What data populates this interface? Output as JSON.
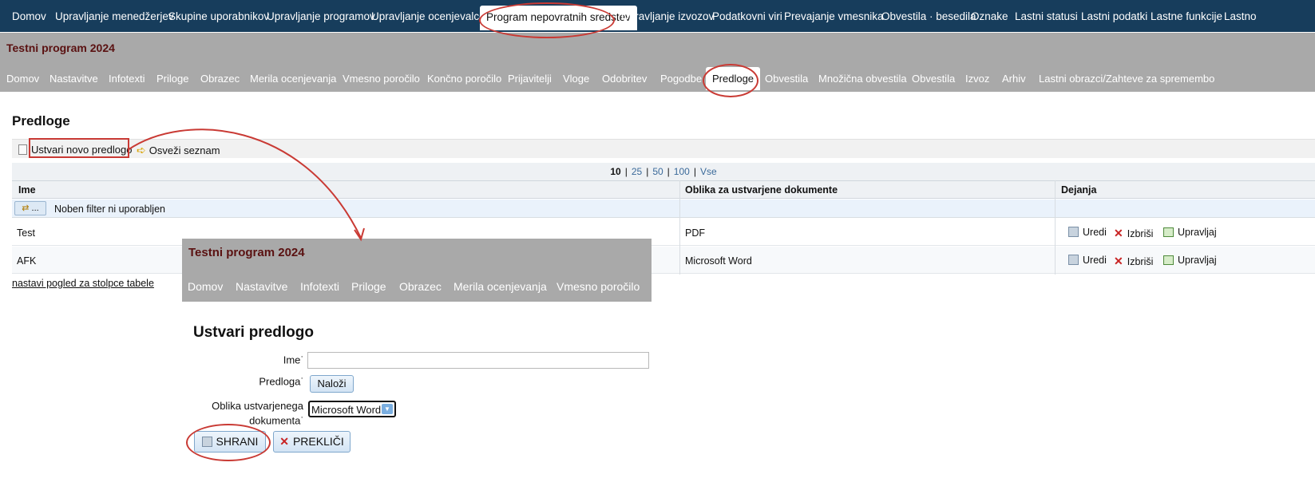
{
  "top_nav": [
    "Domov",
    "Upravljanje menedžerjev",
    "Skupine uporabnikov",
    "Upravljanje programov",
    "Upravljanje ocenjevalcev",
    "Program nepovratnih sredstev",
    "Upravljanje izvozov",
    "Podatkovni viri",
    "Prevajanje vmesnika",
    "Obvestila · besedila",
    "Oznake",
    "Lastni statusi",
    "Lastni podatki",
    "Lastne funkcije",
    "Lastno"
  ],
  "program_title": "Testni program 2024",
  "sub_nav": [
    "Domov",
    "Nastavitve",
    "Infotexti",
    "Priloge",
    "Obrazec",
    "Merila ocenjevanja",
    "Vmesno poročilo",
    "Končno poročilo",
    "Prijavitelji",
    "Vloge",
    "Odobritev",
    "Pogodbe",
    "Predloge",
    "Obvestila",
    "Množična obvestila",
    "Obvestila",
    "Izvoz",
    "Arhiv",
    "Lastni obrazci/Zahteve za spremembo"
  ],
  "page_heading": "Predloge",
  "toolbar": {
    "create": "Ustvari novo predlogo",
    "refresh": "Osveži seznam"
  },
  "pager": {
    "sizes": [
      "10",
      "25",
      "50",
      "100",
      "Vse"
    ],
    "current": "10"
  },
  "table": {
    "headers": [
      "Ime",
      "Oblika za ustvarjene dokumente",
      "Dejanja"
    ],
    "filter_text": "Noben filter ni uporabljen",
    "filter_btn": "...",
    "rows": [
      {
        "name": "Test",
        "format": "PDF"
      },
      {
        "name": "AFK",
        "format": "Microsoft Word"
      }
    ],
    "actions": [
      "Uredi",
      "Izbriši",
      "Upravljaj"
    ]
  },
  "columns_link": "nastavi pogled za stolpce tabele",
  "overlay_nav": [
    "Domov",
    "Nastavitve",
    "Infotexti",
    "Priloge",
    "Obrazec",
    "Merila ocenjevanja",
    "Vmesno poročilo"
  ],
  "form": {
    "heading": "Ustvari predlogo",
    "name_label": "Ime",
    "template_label": "Predloga",
    "upload_btn": "Naloži",
    "format_label_1": "Oblika ustvarjenega",
    "format_label_2": "dokumenta",
    "format_value": "Microsoft Word",
    "save_btn": "SHRANI",
    "cancel_btn": "PREKLIČI"
  },
  "colors": {
    "nav_bg": "#173d5c",
    "band_bg": "#a9a9a9",
    "title": "#5a1111",
    "highlight": "#c93a34"
  }
}
